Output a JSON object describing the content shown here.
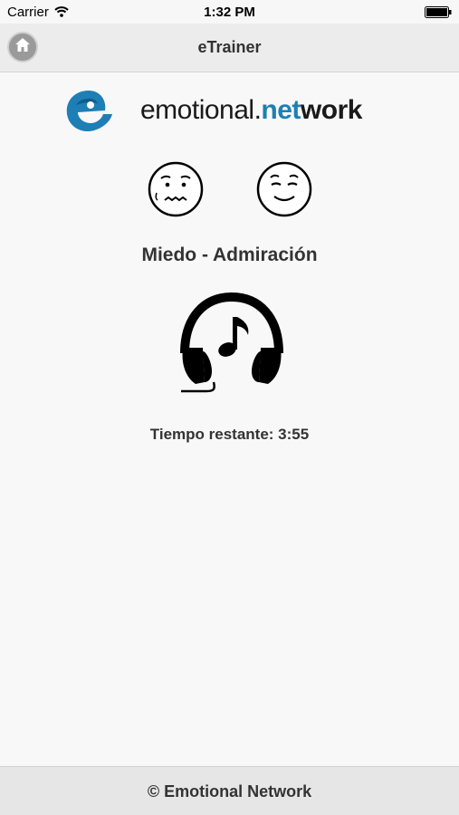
{
  "status_bar": {
    "carrier": "Carrier",
    "time": "1:32 PM"
  },
  "nav": {
    "title": "eTrainer",
    "home_icon": "home-icon"
  },
  "logo": {
    "part1": "emotional.",
    "part2": "net",
    "part3": "work"
  },
  "faces": [
    "fear-face-icon",
    "admiration-face-icon"
  ],
  "session": {
    "emotion_title": "Miedo - Admiración",
    "audio_icon": "headphones-music-icon",
    "time_remaining": "Tiempo restante: 3:55"
  },
  "footer": {
    "copyright": "© Emotional Network"
  },
  "colors": {
    "brand_blue": "#1d7fb5",
    "nav_background": "#ececec",
    "page_background": "#f8f8f8"
  }
}
